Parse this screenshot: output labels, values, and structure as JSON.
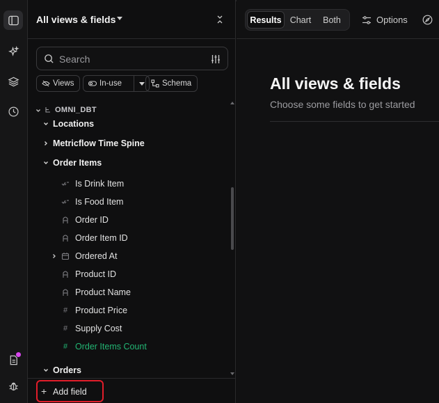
{
  "rail": {
    "items": [
      "panel-toggle-icon",
      "sparkles-icon",
      "layers-icon",
      "clock-icon",
      "document-icon",
      "bug-icon"
    ],
    "notification_color": "#d946ef"
  },
  "sidebar": {
    "title": "All views & fields",
    "search": {
      "placeholder": "Search"
    },
    "chips": {
      "views": "Views",
      "in_use": "In-use",
      "schema": "Schema"
    },
    "schema_name": "OMNI_DBT",
    "views": [
      {
        "label": "Locations",
        "expanded": true
      },
      {
        "label": "Metricflow Time Spine",
        "expanded": false
      },
      {
        "label": "Order Items",
        "expanded": true
      },
      {
        "label": "Orders",
        "expanded": true
      }
    ],
    "order_items_fields": [
      {
        "label": "Is Drink Item",
        "type": "boolean"
      },
      {
        "label": "Is Food Item",
        "type": "boolean"
      },
      {
        "label": "Order ID",
        "type": "string"
      },
      {
        "label": "Order Item ID",
        "type": "string"
      },
      {
        "label": "Ordered At",
        "type": "date"
      },
      {
        "label": "Product ID",
        "type": "string"
      },
      {
        "label": "Product Name",
        "type": "string"
      },
      {
        "label": "Product Price",
        "type": "number"
      },
      {
        "label": "Supply Cost",
        "type": "number"
      },
      {
        "label": "Order Items Count",
        "type": "measure"
      }
    ],
    "add_field": "Add field",
    "measure_color": "#22b573",
    "highlight_color": "#e11d2a"
  },
  "main": {
    "tabs": [
      {
        "label": "Results",
        "active": true
      },
      {
        "label": "Chart",
        "active": false
      },
      {
        "label": "Both",
        "active": false
      }
    ],
    "options_label": "Options",
    "empty_title": "All views & fields",
    "empty_subtitle": "Choose some fields to get started"
  }
}
